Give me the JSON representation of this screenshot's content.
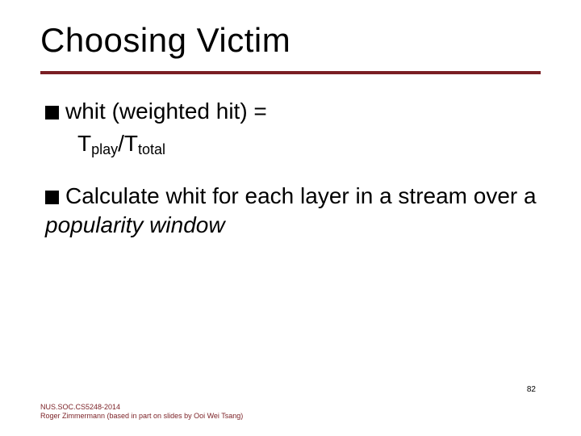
{
  "title": "Choosing Victim",
  "bullets": {
    "b1": {
      "lead": "whit (weighted hit) ="
    },
    "formula": {
      "T1": "T",
      "sub1": "play",
      "slash": "/",
      "T2": "T",
      "sub2": "total"
    },
    "b2": {
      "part1": "Calculate whit for each layer in a stream over a ",
      "ital": "popularity window"
    }
  },
  "page_number": "82",
  "footer": {
    "line1": "NUS.SOC.CS5248-2014",
    "line2": "Roger Zimmermann (based in part on slides by Ooi Wei Tsang)"
  }
}
